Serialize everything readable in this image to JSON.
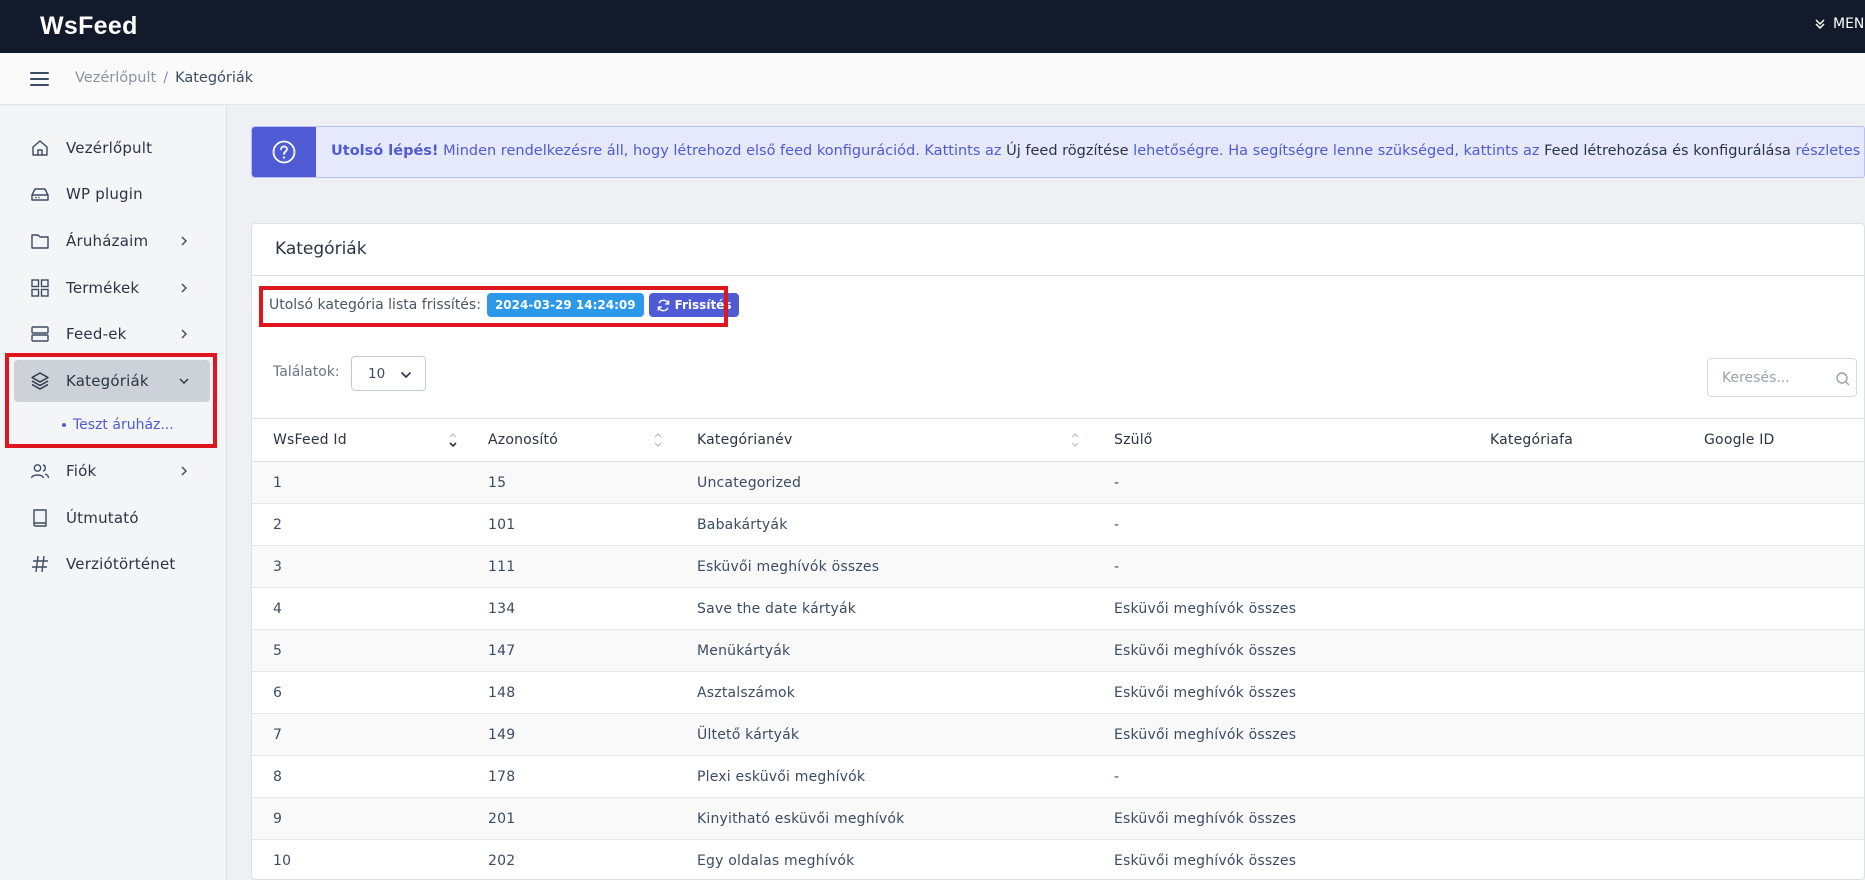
{
  "app": {
    "brand": "WsFeed",
    "menu_label": "MENÜ"
  },
  "header": {
    "breadcrumb": {
      "home": "Vezérlőpult",
      "separator": "/",
      "current": "Kategóriák"
    }
  },
  "sidebar": {
    "items": [
      {
        "label": "Vezérlőpult",
        "icon": "home-icon"
      },
      {
        "label": "WP plugin",
        "icon": "hard-drive-icon"
      },
      {
        "label": "Áruházaim",
        "icon": "folder-icon"
      },
      {
        "label": "Termékek",
        "icon": "grid-icon"
      },
      {
        "label": "Feed-ek",
        "icon": "server-icon"
      },
      {
        "label": "Kategóriák",
        "icon": "layers-icon"
      },
      {
        "label": "Fiók",
        "icon": "users-icon"
      },
      {
        "label": "Útmutató",
        "icon": "book-icon"
      },
      {
        "label": "Verziótörténet",
        "icon": "hash-icon"
      }
    ],
    "sub_item": "Teszt áruház..."
  },
  "alert": {
    "strong": "Utolsó lépés!",
    "part1": " Minden rendelkezésre áll, hogy létrehozd első feed konfigurációd. Kattints az ",
    "dark1": "Új feed rögzítése",
    "part2": " lehetőségre. Ha segítségre lenne szükséged, kattints az ",
    "dark2": "Feed létrehozása és konfigurálása",
    "part3": " részletes leírásra."
  },
  "card": {
    "title": "Kategóriák",
    "refresh_label": "Utolsó kategória lista frissítés:",
    "refresh_date": "2024-03-29 14:24:09",
    "refresh_button": "Frissítés",
    "length_label": "Találatok:",
    "length_value": "10",
    "search_placeholder": "Keresés..."
  },
  "table": {
    "columns": [
      "WsFeed Id",
      "Azonosító",
      "Kategórianév",
      "Szülő",
      "Kategóriafa",
      "Google ID"
    ],
    "rows": [
      [
        "1",
        "15",
        "Uncategorized",
        "-",
        "",
        ""
      ],
      [
        "2",
        "101",
        "Babakártyák",
        "-",
        "",
        ""
      ],
      [
        "3",
        "111",
        "Esküvői meghívók összes",
        "-",
        "",
        ""
      ],
      [
        "4",
        "134",
        "Save the date kártyák",
        "Esküvői meghívók összes",
        "",
        ""
      ],
      [
        "5",
        "147",
        "Menükártyák",
        "Esküvői meghívók összes",
        "",
        ""
      ],
      [
        "6",
        "148",
        "Asztalszámok",
        "Esküvői meghívók összes",
        "",
        ""
      ],
      [
        "7",
        "149",
        "Ültető kártyák",
        "Esküvői meghívók összes",
        "",
        ""
      ],
      [
        "8",
        "178",
        "Plexi esküvői meghívók",
        "-",
        "",
        ""
      ],
      [
        "9",
        "201",
        "Kinyitható esküvői meghívók",
        "Esküvői meghívók összes",
        "",
        ""
      ],
      [
        "10",
        "202",
        "Egy oldalas meghívók",
        "Esküvői meghívók összes",
        "",
        ""
      ]
    ]
  },
  "colors": {
    "accent": "#4f5bd5",
    "info": "#2c98ea",
    "highlight": "#e0161f",
    "topbar": "#121a2b"
  }
}
